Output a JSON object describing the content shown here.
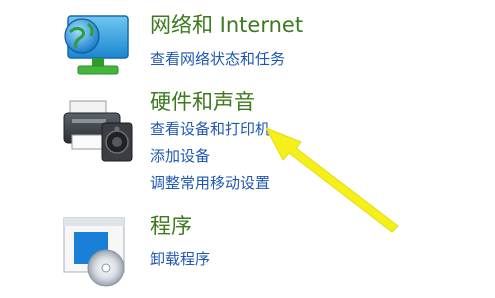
{
  "categories": [
    {
      "title": "网络和 Internet",
      "icon": "globe-network-icon",
      "links": [
        "查看网络状态和任务"
      ]
    },
    {
      "title": "硬件和声音",
      "icon": "printer-speaker-icon",
      "links": [
        "查看设备和打印机",
        "添加设备",
        "调整常用移动设置"
      ]
    },
    {
      "title": "程序",
      "icon": "programs-disc-icon",
      "links": [
        "卸载程序"
      ]
    }
  ],
  "colors": {
    "title": "#3c7a1e",
    "link": "#1f57b5",
    "arrow": "#f5f01a"
  }
}
